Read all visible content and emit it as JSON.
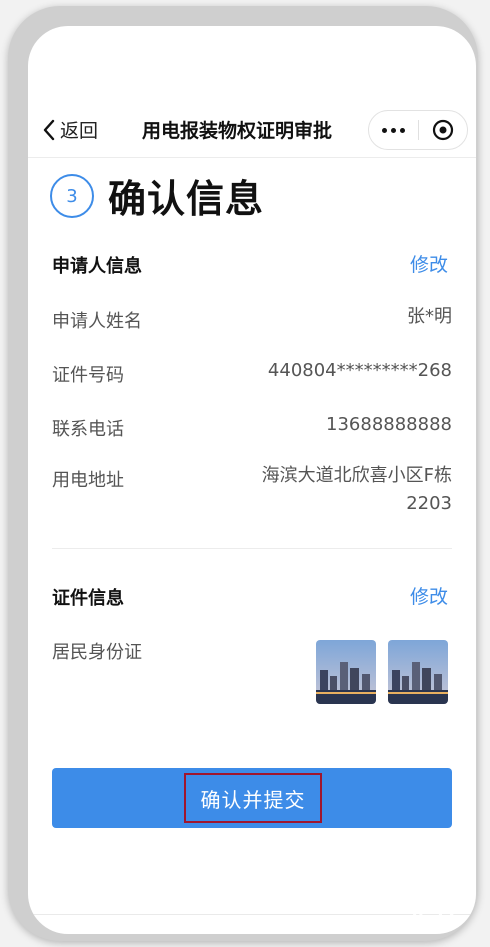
{
  "navbar": {
    "back_label": "返回",
    "title": "用电报装物权证明审批"
  },
  "step": {
    "number": "3",
    "title": "确认信息"
  },
  "applicant_section": {
    "heading": "申请人信息",
    "edit_label": "修改",
    "fields": [
      {
        "label": "申请人姓名",
        "value": "张*明"
      },
      {
        "label": "证件号码",
        "value": "440804*********268"
      },
      {
        "label": "联系电话",
        "value": "13688888888"
      },
      {
        "label": "用电地址",
        "value_line1": "海滨大道北欣喜小区F栋",
        "value_line2": "2203"
      }
    ]
  },
  "document_section": {
    "heading": "证件信息",
    "edit_label": "修改",
    "id_type": "居民身份证"
  },
  "submit_label": "确认并提交",
  "colors": {
    "accent": "#3d8ce8",
    "highlight_border": "#a0162e"
  }
}
